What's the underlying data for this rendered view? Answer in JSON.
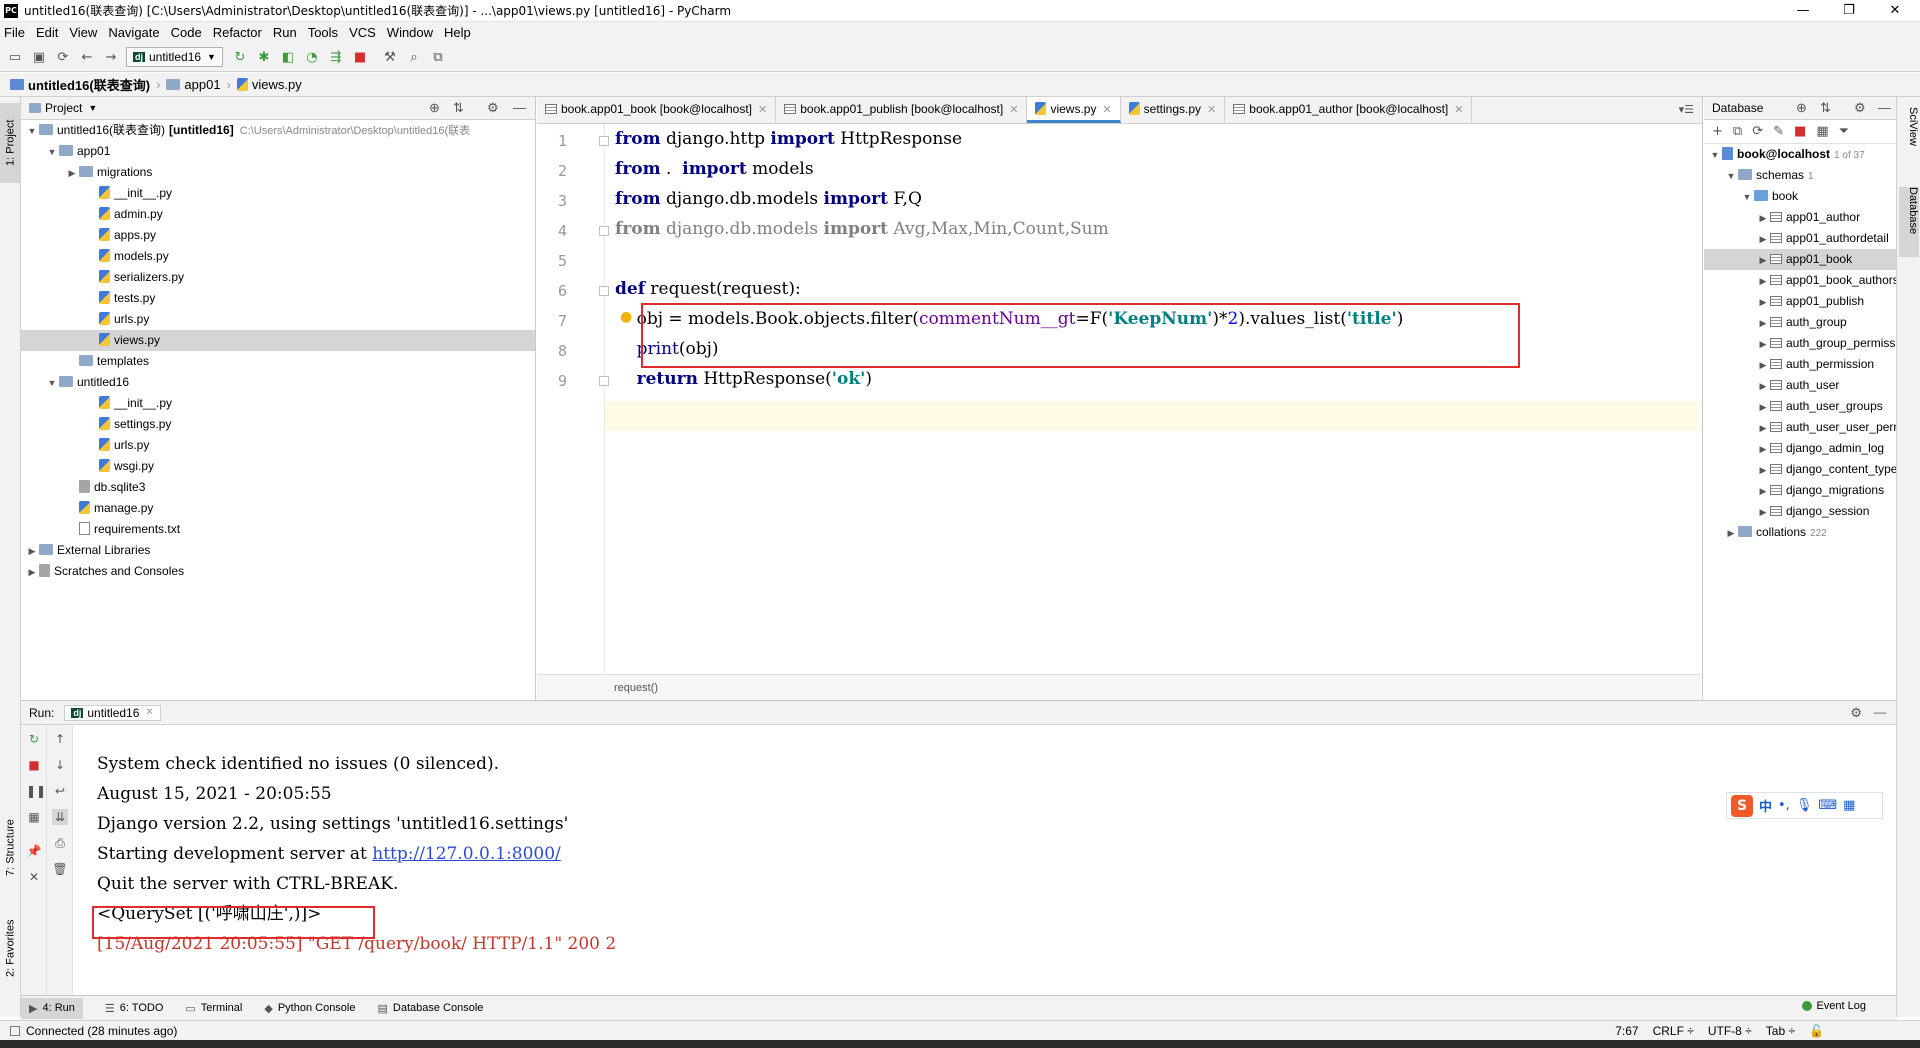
{
  "window": {
    "title": "untitled16(联表查询) [C:\\Users\\Administrator\\Desktop\\untitled16(联表查询)] - ...\\app01\\views.py [untitled16] - PyCharm",
    "app_logo": "PC",
    "controls": [
      "—",
      "❐",
      "✕"
    ]
  },
  "menu": [
    "File",
    "Edit",
    "View",
    "Navigate",
    "Code",
    "Refactor",
    "Run",
    "Tools",
    "VCS",
    "Window",
    "Help"
  ],
  "toolbar": {
    "run_config": "untitled16",
    "run_config_badge": "dj"
  },
  "breadcrumb": [
    "untitled16(联表查询)",
    "app01",
    "views.py"
  ],
  "left_strip": {
    "project_tab": "1: Project",
    "structure_tab": "7: Structure",
    "favorites_tab": "2: Favorites"
  },
  "project": {
    "header": "Project",
    "tree": [
      {
        "label": "untitled16(联表查询)",
        "bold_suffix": "[untitled16]",
        "path": "C:\\Users\\Administrator\\Desktop\\untitled16(联表",
        "depth": 0,
        "arrow": "▼",
        "icon": "folder"
      },
      {
        "label": "app01",
        "depth": 1,
        "arrow": "▼",
        "icon": "folder"
      },
      {
        "label": "migrations",
        "depth": 2,
        "arrow": "▶",
        "icon": "folder"
      },
      {
        "label": "__init__.py",
        "depth": 3,
        "arrow": "",
        "icon": "py"
      },
      {
        "label": "admin.py",
        "depth": 3,
        "arrow": "",
        "icon": "py"
      },
      {
        "label": "apps.py",
        "depth": 3,
        "arrow": "",
        "icon": "py"
      },
      {
        "label": "models.py",
        "depth": 3,
        "arrow": "",
        "icon": "py"
      },
      {
        "label": "serializers.py",
        "depth": 3,
        "arrow": "",
        "icon": "py"
      },
      {
        "label": "tests.py",
        "depth": 3,
        "arrow": "",
        "icon": "py"
      },
      {
        "label": "urls.py",
        "depth": 3,
        "arrow": "",
        "icon": "py"
      },
      {
        "label": "views.py",
        "depth": 3,
        "arrow": "",
        "icon": "py",
        "selected": true
      },
      {
        "label": "templates",
        "depth": 2,
        "arrow": "",
        "icon": "folder"
      },
      {
        "label": "untitled16",
        "depth": 1,
        "arrow": "▼",
        "icon": "folder"
      },
      {
        "label": "__init__.py",
        "depth": 3,
        "arrow": "",
        "icon": "py"
      },
      {
        "label": "settings.py",
        "depth": 3,
        "arrow": "",
        "icon": "py"
      },
      {
        "label": "urls.py",
        "depth": 3,
        "arrow": "",
        "icon": "py"
      },
      {
        "label": "wsgi.py",
        "depth": 3,
        "arrow": "",
        "icon": "py"
      },
      {
        "label": "db.sqlite3",
        "depth": 2,
        "arrow": "",
        "icon": "db"
      },
      {
        "label": "manage.py",
        "depth": 2,
        "arrow": "",
        "icon": "py"
      },
      {
        "label": "requirements.txt",
        "depth": 2,
        "arrow": "",
        "icon": "txt"
      },
      {
        "label": "External Libraries",
        "depth": 0,
        "arrow": "▶",
        "icon": "lib"
      },
      {
        "label": "Scratches and Consoles",
        "depth": 0,
        "arrow": "▶",
        "icon": "scratch"
      }
    ]
  },
  "editor": {
    "tabs": [
      {
        "label": "book.app01_book [book@localhost]",
        "icon": "table"
      },
      {
        "label": "book.app01_publish [book@localhost]",
        "icon": "table"
      },
      {
        "label": "views.py",
        "icon": "py",
        "active": true
      },
      {
        "label": "settings.py",
        "icon": "py"
      },
      {
        "label": "book.app01_author [book@localhost]",
        "icon": "table"
      }
    ],
    "line_numbers": [
      "1",
      "2",
      "3",
      "4",
      "5",
      "6",
      "7",
      "8",
      "9"
    ],
    "footer": "request()"
  },
  "database": {
    "header": "Database",
    "root": "book@localhost",
    "root_count": "1 of 37",
    "schemas_label": "schemas",
    "schemas_count": "1",
    "schema": "book",
    "tables": [
      "app01_author",
      "app01_authordetail",
      "app01_book",
      "app01_book_authors",
      "app01_publish",
      "auth_group",
      "auth_group_permissions",
      "auth_permission",
      "auth_user",
      "auth_user_groups",
      "auth_user_user_permissions",
      "django_admin_log",
      "django_content_type",
      "django_migrations",
      "django_session"
    ],
    "selected_table": "app01_book",
    "collations_label": "collations",
    "collations_count": "222",
    "right_tabs": [
      "SciView",
      "Database"
    ]
  },
  "run": {
    "label": "Run:",
    "config": "untitled16",
    "console": [
      "System check identified no issues (0 silenced).",
      "August 15, 2021 - 20:05:55",
      "Django version 2.2, using settings 'untitled16.settings'",
      "Starting development server at ",
      "Quit the server with CTRL-BREAK.",
      "<QuerySet [('呼啸山庄',)]>",
      "[15/Aug/2021 20:05:55] \"GET /query/book/ HTTP/1.1\" 200 2"
    ],
    "server_url": "http://127.0.0.1:8000/"
  },
  "bottom_tabs": [
    "4: Run",
    "6: TODO",
    "Terminal",
    "Python Console",
    "Database Console"
  ],
  "event_log": "Event Log",
  "status": {
    "message": "Connected (28 minutes ago)",
    "position": "7:67",
    "line_sep": "CRLF",
    "encoding": "UTF-8",
    "indent": "Tab"
  },
  "ime": {
    "logo": "S",
    "lang": "中"
  }
}
